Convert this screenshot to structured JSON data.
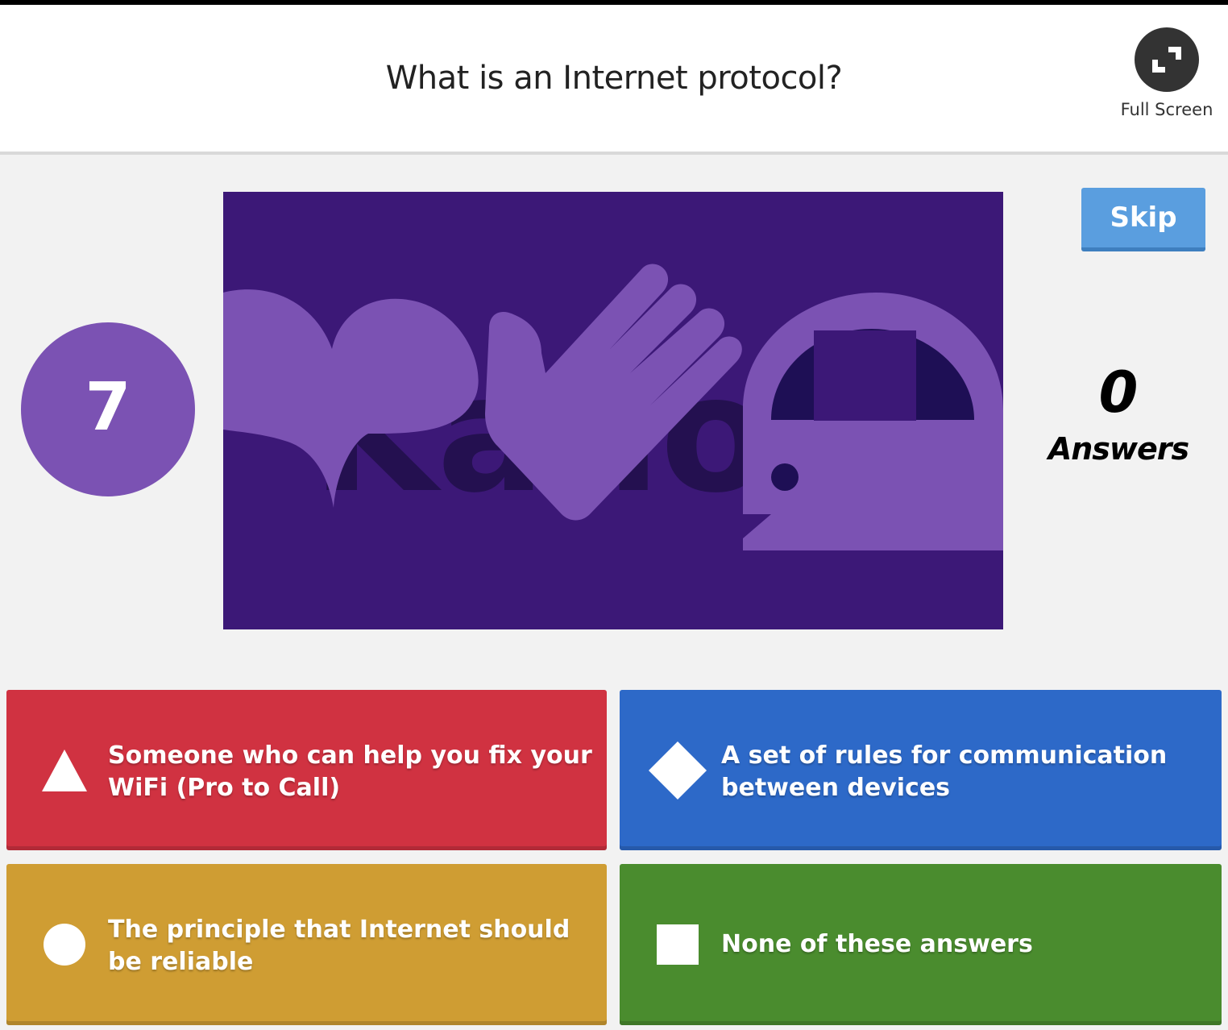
{
  "question": {
    "title": "What is an Internet protocol?"
  },
  "fullscreen": {
    "label": "Full Screen",
    "icon": "expand-icon"
  },
  "timer": {
    "value": "7"
  },
  "skip": {
    "label": "Skip"
  },
  "answers_count": {
    "value": "0",
    "label": "Answers"
  },
  "media": {
    "watermark": "Kahoot",
    "icons": [
      "heart-icon",
      "hand-icon",
      "speech-bubble-icon"
    ]
  },
  "answers": [
    {
      "shape": "triangle",
      "color": "#d03241",
      "text": "Someone who can help you fix your WiFi (Pro to Call)"
    },
    {
      "shape": "diamond",
      "color": "#2d69c8",
      "text": "A set of rules for communication between devices"
    },
    {
      "shape": "circle",
      "color": "#cf9d33",
      "text": "The principle that Internet should be reliable"
    },
    {
      "shape": "square",
      "color": "#4a8c2e",
      "text": "None of these answers"
    }
  ]
}
